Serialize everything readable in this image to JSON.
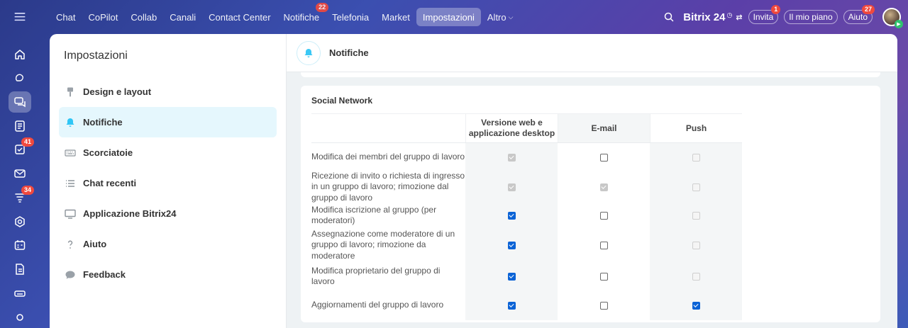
{
  "rail": {
    "badges": {
      "tasks": "41",
      "feed": "34"
    }
  },
  "topnav": {
    "items": [
      {
        "label": "Chat"
      },
      {
        "label": "CoPilot"
      },
      {
        "label": "Collab"
      },
      {
        "label": "Canali"
      },
      {
        "label": "Contact Center"
      },
      {
        "label": "Notifiche",
        "badge": "22"
      },
      {
        "label": "Telefonia"
      },
      {
        "label": "Market"
      },
      {
        "label": "Impostazioni",
        "active": true
      },
      {
        "label": "Altro"
      }
    ],
    "brand": "Bitrix 24",
    "invite_label": "Invita",
    "invite_badge": "1",
    "plan_label": "Il mio piano",
    "help_label": "Aiuto",
    "help_badge": "27"
  },
  "settings": {
    "title": "Impostazioni",
    "menu": [
      {
        "label": "Design e layout",
        "icon": "brush-icon"
      },
      {
        "label": "Notifiche",
        "icon": "bell-icon",
        "active": true
      },
      {
        "label": "Scorciatoie",
        "icon": "keyboard-icon"
      },
      {
        "label": "Chat recenti",
        "icon": "list-icon"
      },
      {
        "label": "Applicazione Bitrix24",
        "icon": "monitor-icon"
      },
      {
        "label": "Aiuto",
        "icon": "question-icon"
      },
      {
        "label": "Feedback",
        "icon": "chat-bubble-icon"
      }
    ]
  },
  "content": {
    "title": "Notifiche",
    "section_title": "Social Network",
    "columns": {
      "web": "Versione web e applicazione desktop",
      "email": "E-mail",
      "push": "Push"
    },
    "rows": [
      {
        "label": "Modifica dei membri del gruppo di lavoro",
        "web": {
          "checked": true,
          "disabled": true
        },
        "email": {
          "checked": false,
          "disabled": false
        },
        "push": {
          "checked": false,
          "disabled": true
        }
      },
      {
        "label": "Ricezione di invito o richiesta di ingresso in un gruppo di lavoro; rimozione dal gruppo di lavoro",
        "web": {
          "checked": true,
          "disabled": true
        },
        "email": {
          "checked": true,
          "disabled": true
        },
        "push": {
          "checked": false,
          "disabled": true
        }
      },
      {
        "label": "Modifica iscrizione al gruppo (per moderatori)",
        "web": {
          "checked": true,
          "disabled": false
        },
        "email": {
          "checked": false,
          "disabled": false
        },
        "push": {
          "checked": false,
          "disabled": true
        }
      },
      {
        "label": "Assegnazione come moderatore di un gruppo di lavoro; rimozione da moderatore",
        "web": {
          "checked": true,
          "disabled": false
        },
        "email": {
          "checked": false,
          "disabled": false
        },
        "push": {
          "checked": false,
          "disabled": true
        }
      },
      {
        "label": "Modifica proprietario del gruppo di lavoro",
        "web": {
          "checked": true,
          "disabled": false
        },
        "email": {
          "checked": false,
          "disabled": false
        },
        "push": {
          "checked": false,
          "disabled": true
        }
      },
      {
        "label": "Aggiornamenti del gruppo di lavoro",
        "web": {
          "checked": true,
          "disabled": false
        },
        "email": {
          "checked": false,
          "disabled": false
        },
        "push": {
          "checked": true,
          "disabled": false
        }
      }
    ]
  }
}
